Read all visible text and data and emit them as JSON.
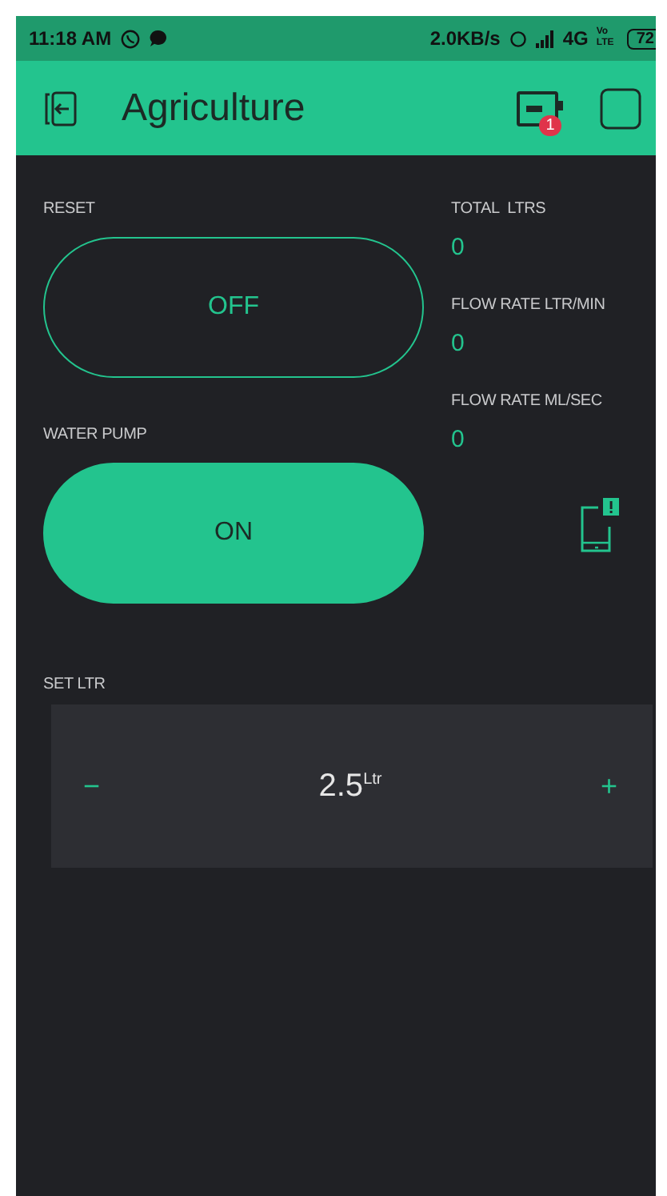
{
  "status_bar": {
    "time": "11:18 AM",
    "speed": "2.0KB/s",
    "network": "4G",
    "volte": "Vo LTE",
    "battery": "72"
  },
  "header": {
    "title": "Agriculture",
    "device_badge": "1"
  },
  "buttons": [
    {
      "label": "RESET",
      "text": "OFF",
      "on": false
    },
    {
      "label": "WATER PUMP",
      "text": "ON",
      "on": true
    }
  ],
  "displays": [
    {
      "label": "TOTAL  LTRS",
      "value": "0"
    },
    {
      "label": "FLOW RATE LTR/MIN",
      "value": "0"
    },
    {
      "label": "FLOW RATE ML/SEC",
      "value": "0"
    }
  ],
  "stepper": {
    "label": "SET LTR",
    "minus": "−",
    "value": "2.5$^{Ltr}$",
    "plus": "+"
  }
}
